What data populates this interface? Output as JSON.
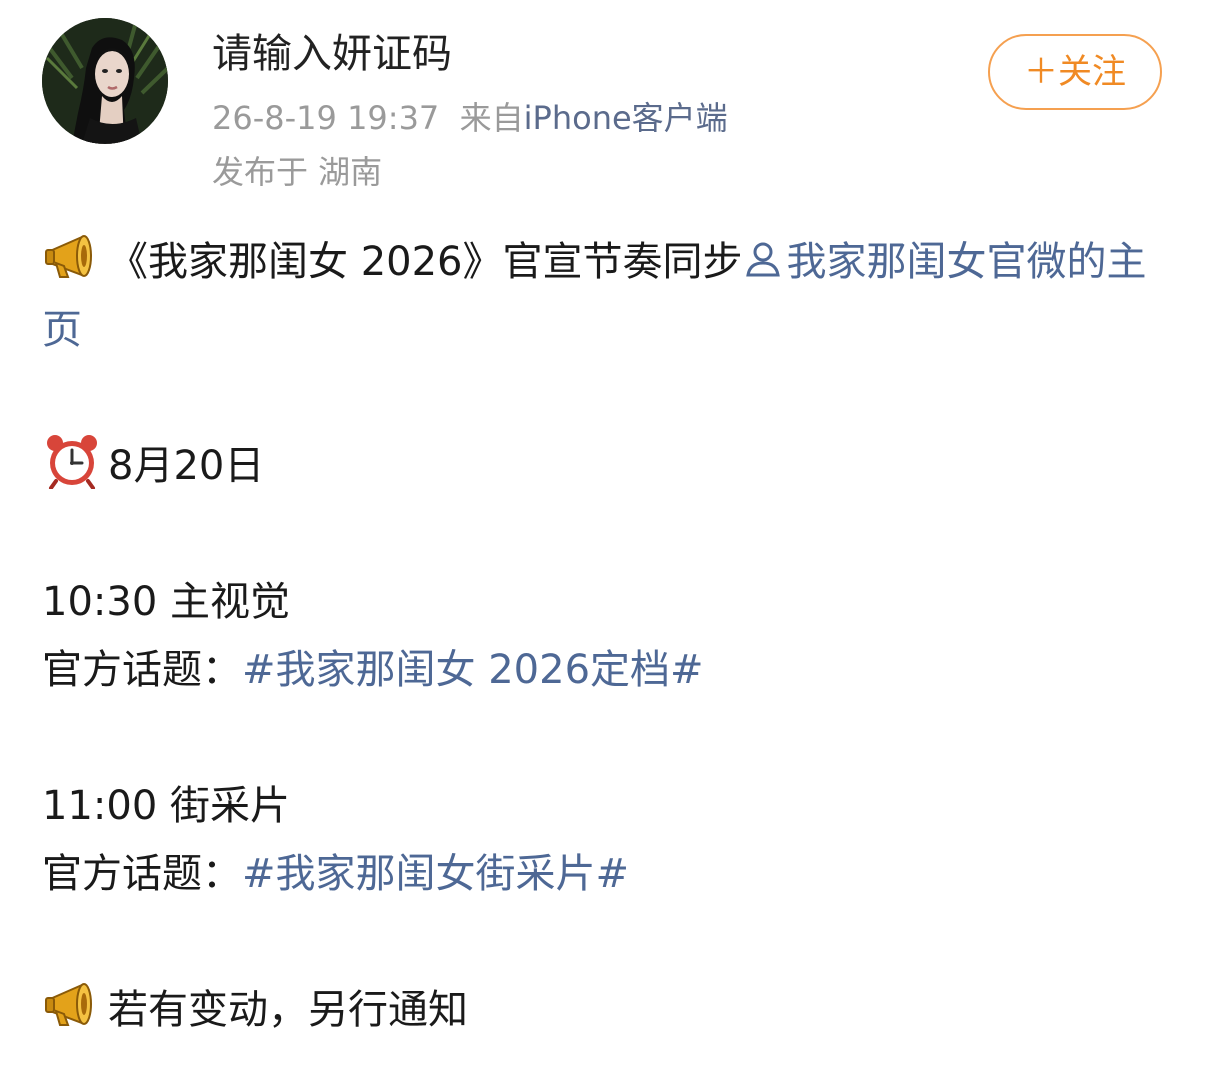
{
  "post": {
    "author": {
      "name": "请输入妍证码",
      "avatar_icon": "avatar-photo"
    },
    "timestamp": "26-8-19 19:37",
    "source_prefix": "来自",
    "source_app": "iPhone客户端",
    "location": "发布于 湖南",
    "follow_label": "＋关注",
    "body": {
      "line1_text": "《我家那闺女 2026》官宣节奏同步",
      "line1_mention": "我家那闺女官微的主页",
      "line1_icon": "megaphone-icon",
      "date_icon": "alarm-clock-icon",
      "date": "8月20日",
      "item1_time_title": "10:30 主视觉",
      "item1_topic_label": "官方话题：",
      "item1_topic": "#我家那闺女 2026定档#",
      "item2_time_title": "11:00 街采片",
      "item2_topic_label": "官方话题：",
      "item2_topic": "#我家那闺女街采片#",
      "notice_icon": "megaphone-icon",
      "notice": "若有变动，另行通知"
    }
  },
  "colors": {
    "link": "#4e6895",
    "follow_accent": "#f08a24",
    "meta_gray": "#9a9a9a"
  }
}
